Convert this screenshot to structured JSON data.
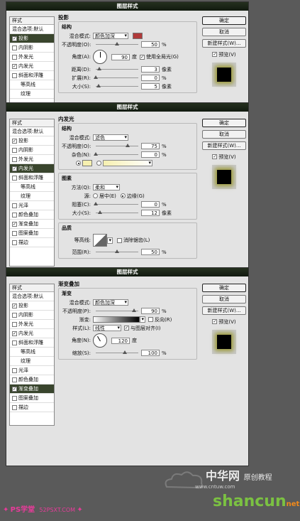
{
  "dialog_title": "图层样式",
  "buttons": {
    "ok": "确定",
    "cancel": "取消",
    "new_style": "新建样式(W)...",
    "preview": "预览(V)"
  },
  "sidebar": {
    "header": "样式",
    "blend": "混合选项:默认",
    "items": [
      "投影",
      "内阴影",
      "外发光",
      "内发光",
      "斜面和浮雕",
      "等高线",
      "纹理",
      "光泽",
      "颜色叠加",
      "渐变叠加",
      "图案叠加",
      "描边"
    ]
  },
  "panel1": {
    "section": "投影",
    "sub": "结构",
    "blend_label": "混合模式:",
    "blend_value": "颜色加深",
    "color": "#b03a3a",
    "opacity_label": "不透明度(O):",
    "opacity": "50",
    "angle_label": "角度(A):",
    "angle": "90",
    "angle_unit": "度",
    "global_light": "使用全局光(G)",
    "distance_label": "距离(D):",
    "distance": "3",
    "spread_label": "扩展(R):",
    "spread": "0",
    "size_label": "大小(S):",
    "size": "5",
    "px": "像素",
    "pct": "%"
  },
  "panel2": {
    "section": "内发光",
    "sub": "结构",
    "blend_label": "混合模式:",
    "blend_value": "滤色",
    "opacity_label": "不透明度(O):",
    "opacity": "75",
    "noise_label": "杂色(N):",
    "noise": "0",
    "glow_color": "#f6f0b0",
    "sec2": "图素",
    "method_label": "方法(Q):",
    "method_value": "柔和",
    "source_label": "源:",
    "center": "居中(E)",
    "edge": "边缘(G)",
    "choke_label": "阻塞(C):",
    "choke": "0",
    "size_label": "大小(S):",
    "size": "12",
    "px": "像素",
    "pct": "%",
    "sec3": "品质",
    "contour_label": "等高线:",
    "anti_alias": "消除锯齿(L)",
    "range_label": "范围(R):",
    "range": "50"
  },
  "panel3": {
    "section": "渐变叠加",
    "sub": "渐变",
    "blend_label": "混合模式:",
    "blend_value": "颜色加深",
    "opacity_label": "不透明度(P):",
    "opacity": "90",
    "gradient_label": "渐变:",
    "reverse": "反向(R)",
    "style_label": "样式(L):",
    "style_value": "线性",
    "align": "与图层对齐(I)",
    "angle_label": "角度(N):",
    "angle": "120",
    "angle_unit": "度",
    "scale_label": "缩放(S):",
    "scale": "100",
    "pct": "%"
  },
  "footer": {
    "left_logo": "PS学堂",
    "left_url": "52PSXT.COM",
    "brand": "中华网",
    "tutorial": "原创教程",
    "url": "www.cntuw.com",
    "shancun": "shancun",
    "net": "net"
  }
}
